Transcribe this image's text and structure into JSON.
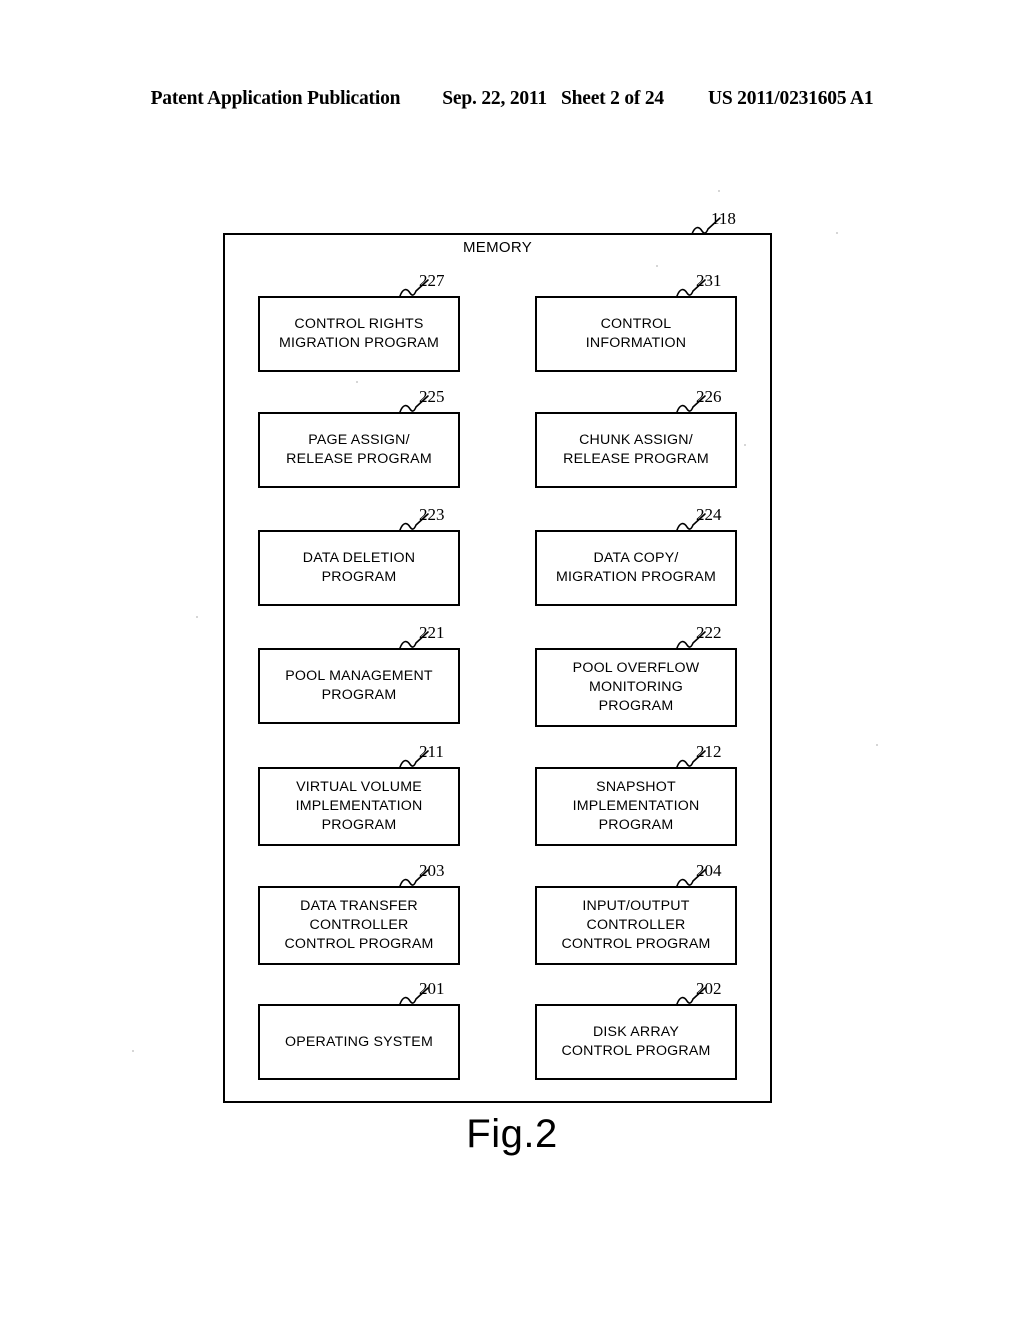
{
  "header": {
    "publication": "Patent Application Publication",
    "date": "Sep. 22, 2011",
    "sheet": "Sheet 2 of 24",
    "pub_number": "US 2011/0231605 A1"
  },
  "figure": {
    "caption": "Fig.2",
    "container": {
      "title": "MEMORY",
      "ref": "118"
    },
    "blocks": [
      {
        "ref": "227",
        "column": "left",
        "row": 1,
        "lines": [
          "CONTROL RIGHTS",
          "MIGRATION PROGRAM"
        ]
      },
      {
        "ref": "231",
        "column": "right",
        "row": 1,
        "lines": [
          "CONTROL",
          "INFORMATION"
        ]
      },
      {
        "ref": "225",
        "column": "left",
        "row": 2,
        "lines": [
          "PAGE ASSIGN/",
          "RELEASE PROGRAM"
        ]
      },
      {
        "ref": "226",
        "column": "right",
        "row": 2,
        "lines": [
          "CHUNK ASSIGN/",
          "RELEASE PROGRAM"
        ]
      },
      {
        "ref": "223",
        "column": "left",
        "row": 3,
        "lines": [
          "DATA DELETION",
          "PROGRAM"
        ]
      },
      {
        "ref": "224",
        "column": "right",
        "row": 3,
        "lines": [
          "DATA COPY/",
          "MIGRATION PROGRAM"
        ]
      },
      {
        "ref": "221",
        "column": "left",
        "row": 4,
        "lines": [
          "POOL MANAGEMENT",
          "PROGRAM"
        ]
      },
      {
        "ref": "222",
        "column": "right",
        "row": 4,
        "lines": [
          "POOL OVERFLOW",
          "MONITORING",
          "PROGRAM"
        ]
      },
      {
        "ref": "211",
        "column": "left",
        "row": 5,
        "lines": [
          "VIRTUAL VOLUME",
          "IMPLEMENTATION",
          "PROGRAM"
        ]
      },
      {
        "ref": "212",
        "column": "right",
        "row": 5,
        "lines": [
          "SNAPSHOT",
          "IMPLEMENTATION",
          "PROGRAM"
        ]
      },
      {
        "ref": "203",
        "column": "left",
        "row": 6,
        "lines": [
          "DATA TRANSFER",
          "CONTROLLER",
          "CONTROL PROGRAM"
        ]
      },
      {
        "ref": "204",
        "column": "right",
        "row": 6,
        "lines": [
          "INPUT/OUTPUT",
          "CONTROLLER",
          "CONTROL PROGRAM"
        ]
      },
      {
        "ref": "201",
        "column": "left",
        "row": 7,
        "lines": [
          "OPERATING SYSTEM"
        ]
      },
      {
        "ref": "202",
        "column": "right",
        "row": 7,
        "lines": [
          "DISK ARRAY",
          "CONTROL PROGRAM"
        ]
      }
    ]
  }
}
